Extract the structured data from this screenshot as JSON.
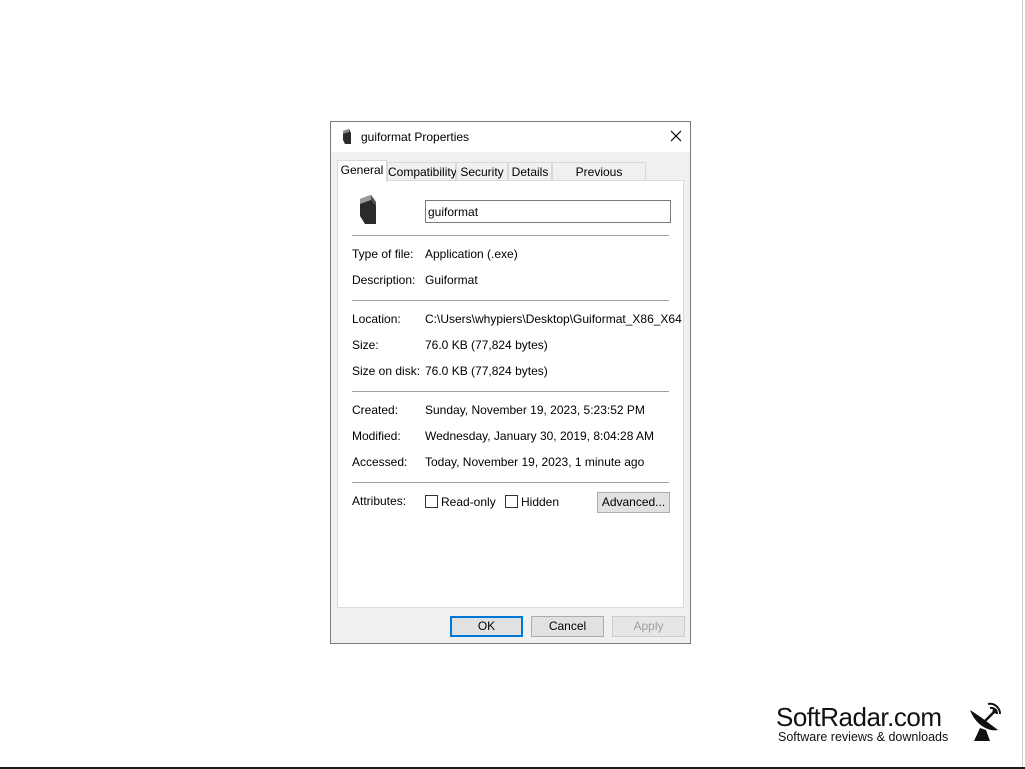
{
  "window": {
    "title": "guiformat Properties",
    "close_icon": "close-icon",
    "app_icon": "usb-drive-icon"
  },
  "tabs": [
    {
      "label": "General",
      "active": true
    },
    {
      "label": "Compatibility",
      "active": false
    },
    {
      "label": "Security",
      "active": false
    },
    {
      "label": "Details",
      "active": false
    },
    {
      "label": "Previous Versions",
      "active": false
    }
  ],
  "general": {
    "file_name": "guiformat",
    "type_of_file": {
      "label": "Type of file:",
      "value": "Application (.exe)"
    },
    "description": {
      "label": "Description:",
      "value": "Guiformat"
    },
    "location": {
      "label": "Location:",
      "value": "C:\\Users\\whypiers\\Desktop\\Guiformat_X86_X64"
    },
    "size": {
      "label": "Size:",
      "value": "76.0 KB (77,824 bytes)"
    },
    "size_on_disk": {
      "label": "Size on disk:",
      "value": "76.0 KB (77,824 bytes)"
    },
    "created": {
      "label": "Created:",
      "value": "Sunday, November 19, 2023, 5:23:52 PM"
    },
    "modified": {
      "label": "Modified:",
      "value": "Wednesday, January 30, 2019, 8:04:28 AM"
    },
    "accessed": {
      "label": "Accessed:",
      "value": "Today, November 19, 2023, 1 minute ago"
    },
    "attributes": {
      "label": "Attributes:",
      "read_only": {
        "label": "Read-only",
        "checked": false
      },
      "hidden": {
        "label": "Hidden",
        "checked": false
      },
      "advanced_label": "Advanced..."
    }
  },
  "buttons": {
    "ok": "OK",
    "cancel": "Cancel",
    "apply": "Apply"
  },
  "watermark": {
    "title": "SoftRadar.com",
    "subtitle": "Software reviews & downloads",
    "icon": "satellite-dish-icon"
  }
}
